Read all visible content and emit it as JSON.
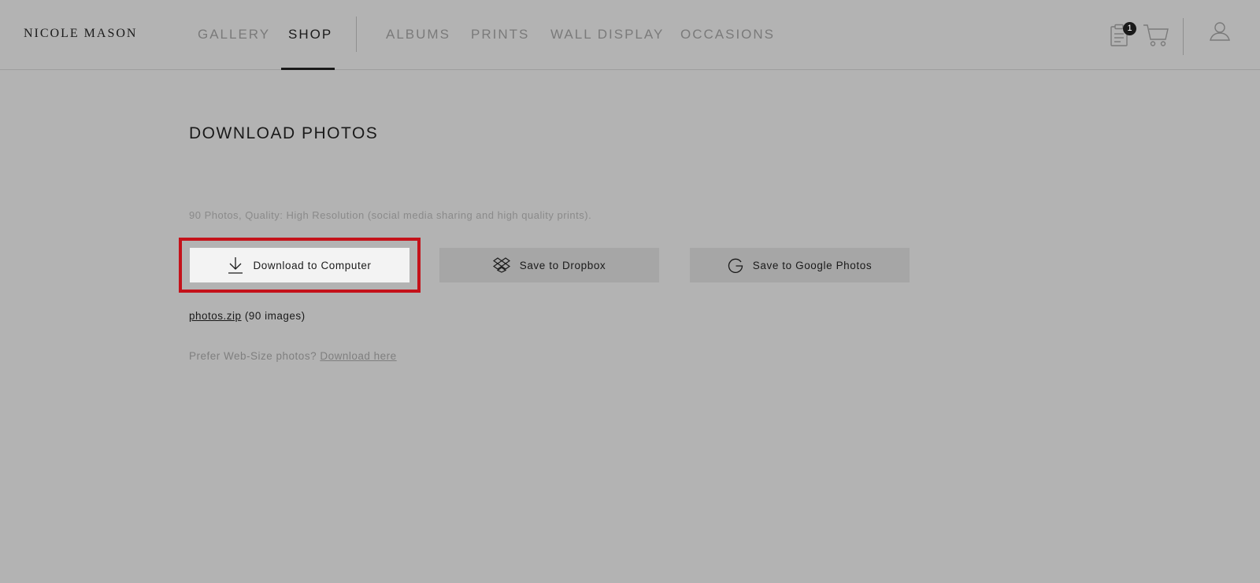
{
  "header": {
    "brand": "NICOLE MASON",
    "nav": [
      {
        "label": "GALLERY",
        "active": false
      },
      {
        "label": "SHOP",
        "active": true
      },
      {
        "label": "ALBUMS",
        "active": false
      },
      {
        "label": "PRINTS",
        "active": false
      },
      {
        "label": "WALL DISPLAY",
        "active": false
      },
      {
        "label": "OCCASIONS",
        "active": false
      }
    ],
    "icons": {
      "orders": "clipboard-icon",
      "cart": "cart-icon",
      "account": "user-icon"
    },
    "orders_badge": "1"
  },
  "main": {
    "title": "DOWNLOAD PHOTOS",
    "quality_text": "90 Photos, Quality: High Resolution (social media sharing and high quality prints).",
    "buttons": {
      "download": "Download to Computer",
      "dropbox": "Save to Dropbox",
      "google": "Save to Google Photos"
    },
    "zip": {
      "link": "photos.zip",
      "count": "(90 images)"
    },
    "prefer": {
      "text": "Prefer Web-Size photos?",
      "link": "Download here"
    }
  },
  "colors": {
    "highlight": "#c4121a",
    "background": "#b3b3b3",
    "primary_button": "#f3f3f3"
  }
}
